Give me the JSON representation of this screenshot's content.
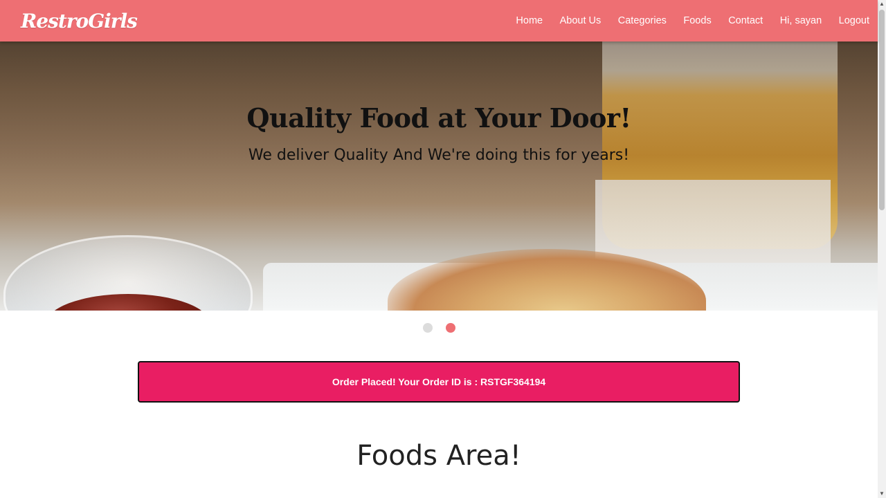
{
  "navbar": {
    "brand": "RestroGirls",
    "links": [
      "Home",
      "About Us",
      "Categories",
      "Foods",
      "Contact",
      "Hi, sayan",
      "Logout"
    ]
  },
  "hero": {
    "title": "Quality Food at Your Door!",
    "subtitle": "We deliver Quality And We're doing this for years!",
    "slides_total": 2,
    "active_slide": 2
  },
  "alert": {
    "message": "Order Placed! Your Order ID is : RSTGF364194"
  },
  "section": {
    "title": "Foods Area!"
  },
  "colors": {
    "navbar": "#ee6f73",
    "alert": "#e91e63",
    "dot_active": "#ee6f73",
    "dot_inactive": "#dcdcdc"
  },
  "icons": {
    "scroll_up": "triangle-up-icon",
    "scroll_down": "triangle-down-icon"
  }
}
